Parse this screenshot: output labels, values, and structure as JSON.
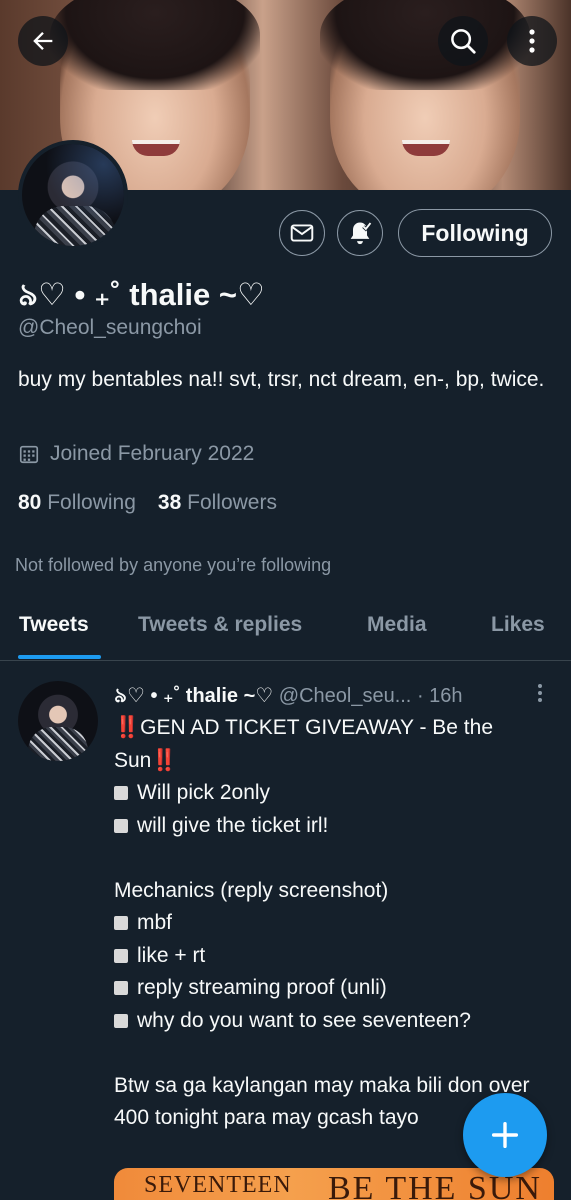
{
  "profile": {
    "display_name": "৯♡ • ₊˚ thalie ~♡",
    "handle": "@Cheol_seungchoi",
    "bio": "buy my bentables na!! svt, trsr, nct dream, en-, bp, twice.",
    "joined": "Joined February 2022",
    "following_count": "80",
    "following_label": "Following",
    "followers_count": "38",
    "followers_label": "Followers",
    "not_followed_text": "Not followed by anyone you’re following",
    "follow_button_label": "Following"
  },
  "tabs": [
    {
      "label": "Tweets",
      "active": true
    },
    {
      "label": "Tweets & replies",
      "active": false
    },
    {
      "label": "Media",
      "active": false
    },
    {
      "label": "Likes",
      "active": false
    }
  ],
  "tweet": {
    "name": "৯♡ • ₊˚ thalie ~♡",
    "handle": "@Cheol_seu...",
    "time": "· 16h",
    "title_bang_left": "‼️",
    "title": "GEN AD TICKET GIVEAWAY - Be the Sun",
    "title_bang_right": "‼️",
    "bullets_a": [
      "Will pick 2only",
      "will give the ticket irl!"
    ],
    "mechanics_label": "Mechanics (reply screenshot)",
    "bullets_b": [
      "mbf",
      "like + rt",
      "reply streaming proof (unli)",
      "why do you want to see seventeen?"
    ],
    "closing": "Btw sa ga kaylangan may maka bili don over 400 tonight para may gcash tayo",
    "media_text_left": "SEVENTEEN",
    "media_text_right": "BE THE SUN"
  },
  "colors": {
    "background": "#15202b",
    "accent": "#1d9bf0",
    "muted_text": "#8b98a5",
    "divider": "#38444d"
  },
  "icons": [
    "back-arrow-icon",
    "search-icon",
    "more-vertical-icon",
    "mail-icon",
    "bell-check-icon",
    "calendar-icon",
    "more-horizontal-icon",
    "plus-icon"
  ]
}
